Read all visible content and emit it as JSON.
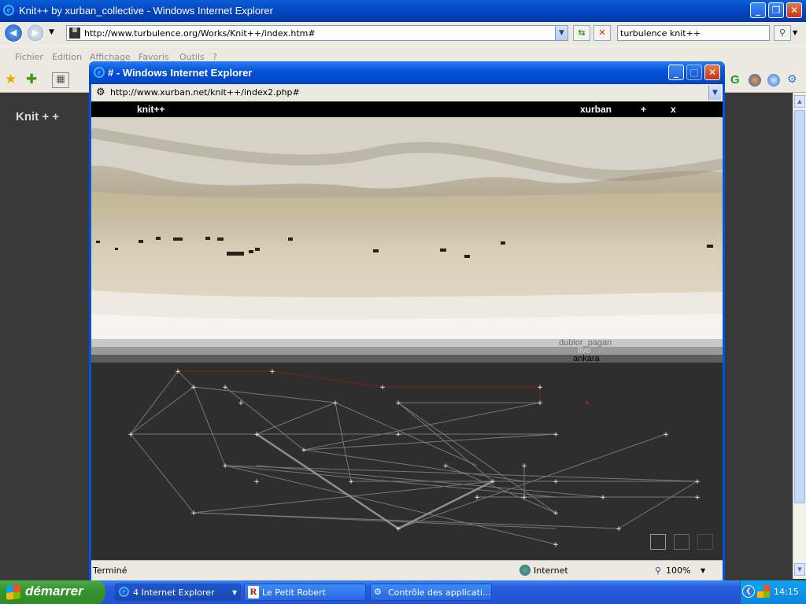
{
  "main_window": {
    "title": "Knit++ by xurban_collective - Windows Internet Explorer",
    "address": "http://www.turbulence.org/Works/Knit++/index.htm#",
    "search": "turbulence knit++",
    "menu": [
      "Fichier",
      "Edition",
      "Affichage",
      "Favoris",
      "Outils",
      "?"
    ]
  },
  "page": {
    "site_title": "Knit + +"
  },
  "popup": {
    "title": "# - Windows Internet Explorer",
    "address": "http://www.xurban.net/knit++/index2.php#",
    "nav": {
      "logo": "knit++",
      "xurban": "xurban",
      "plus": "+",
      "close": "x"
    },
    "location_labels": [
      "dublor_pagan",
      "live",
      "ankara"
    ],
    "status": {
      "text": "Terminé",
      "zone": "Internet",
      "zoom": "100%"
    }
  },
  "taskbar": {
    "start": "démarrer",
    "tasks": [
      "4 Internet Explorer",
      "Le Petit Robert",
      "Contrôle des applicati..."
    ],
    "clock": "14:15"
  },
  "colors": {
    "xp_blue": "#0054e3",
    "page_bg": "#393939",
    "network_line": "#9a9a9a",
    "network_red": "#8b1a1a"
  }
}
